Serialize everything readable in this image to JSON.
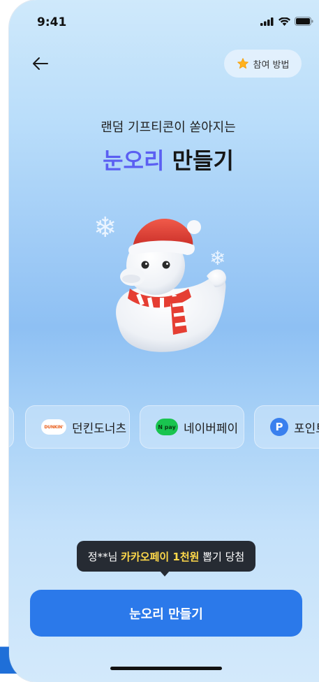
{
  "status_bar": {
    "time": "9:41"
  },
  "header": {
    "back_icon": "arrow-left-icon",
    "how_to_label": "참여 방법",
    "how_to_icon": "star-icon"
  },
  "hero": {
    "subtitle": "랜덤 기프티콘이 쏟아지는",
    "title_accent": "눈오리",
    "title_rest": " 만들기"
  },
  "brands": [
    {
      "label": "",
      "logo": ""
    },
    {
      "label": "던킨도너츠",
      "logo": "DUNKIN'"
    },
    {
      "label": "네이버페이",
      "logo": "N pay"
    },
    {
      "label": "포인트",
      "logo": "P"
    }
  ],
  "toast": {
    "prefix": "정**님 ",
    "highlight": "카카오페이 1천원",
    "suffix": " 뽑기 당첨"
  },
  "cta": {
    "label": "눈오리 만들기"
  },
  "colors": {
    "accent": "#5b5ff2",
    "cta": "#2b79ea",
    "toast_bg": "#262b33",
    "toast_highlight": "#ffd94a"
  }
}
